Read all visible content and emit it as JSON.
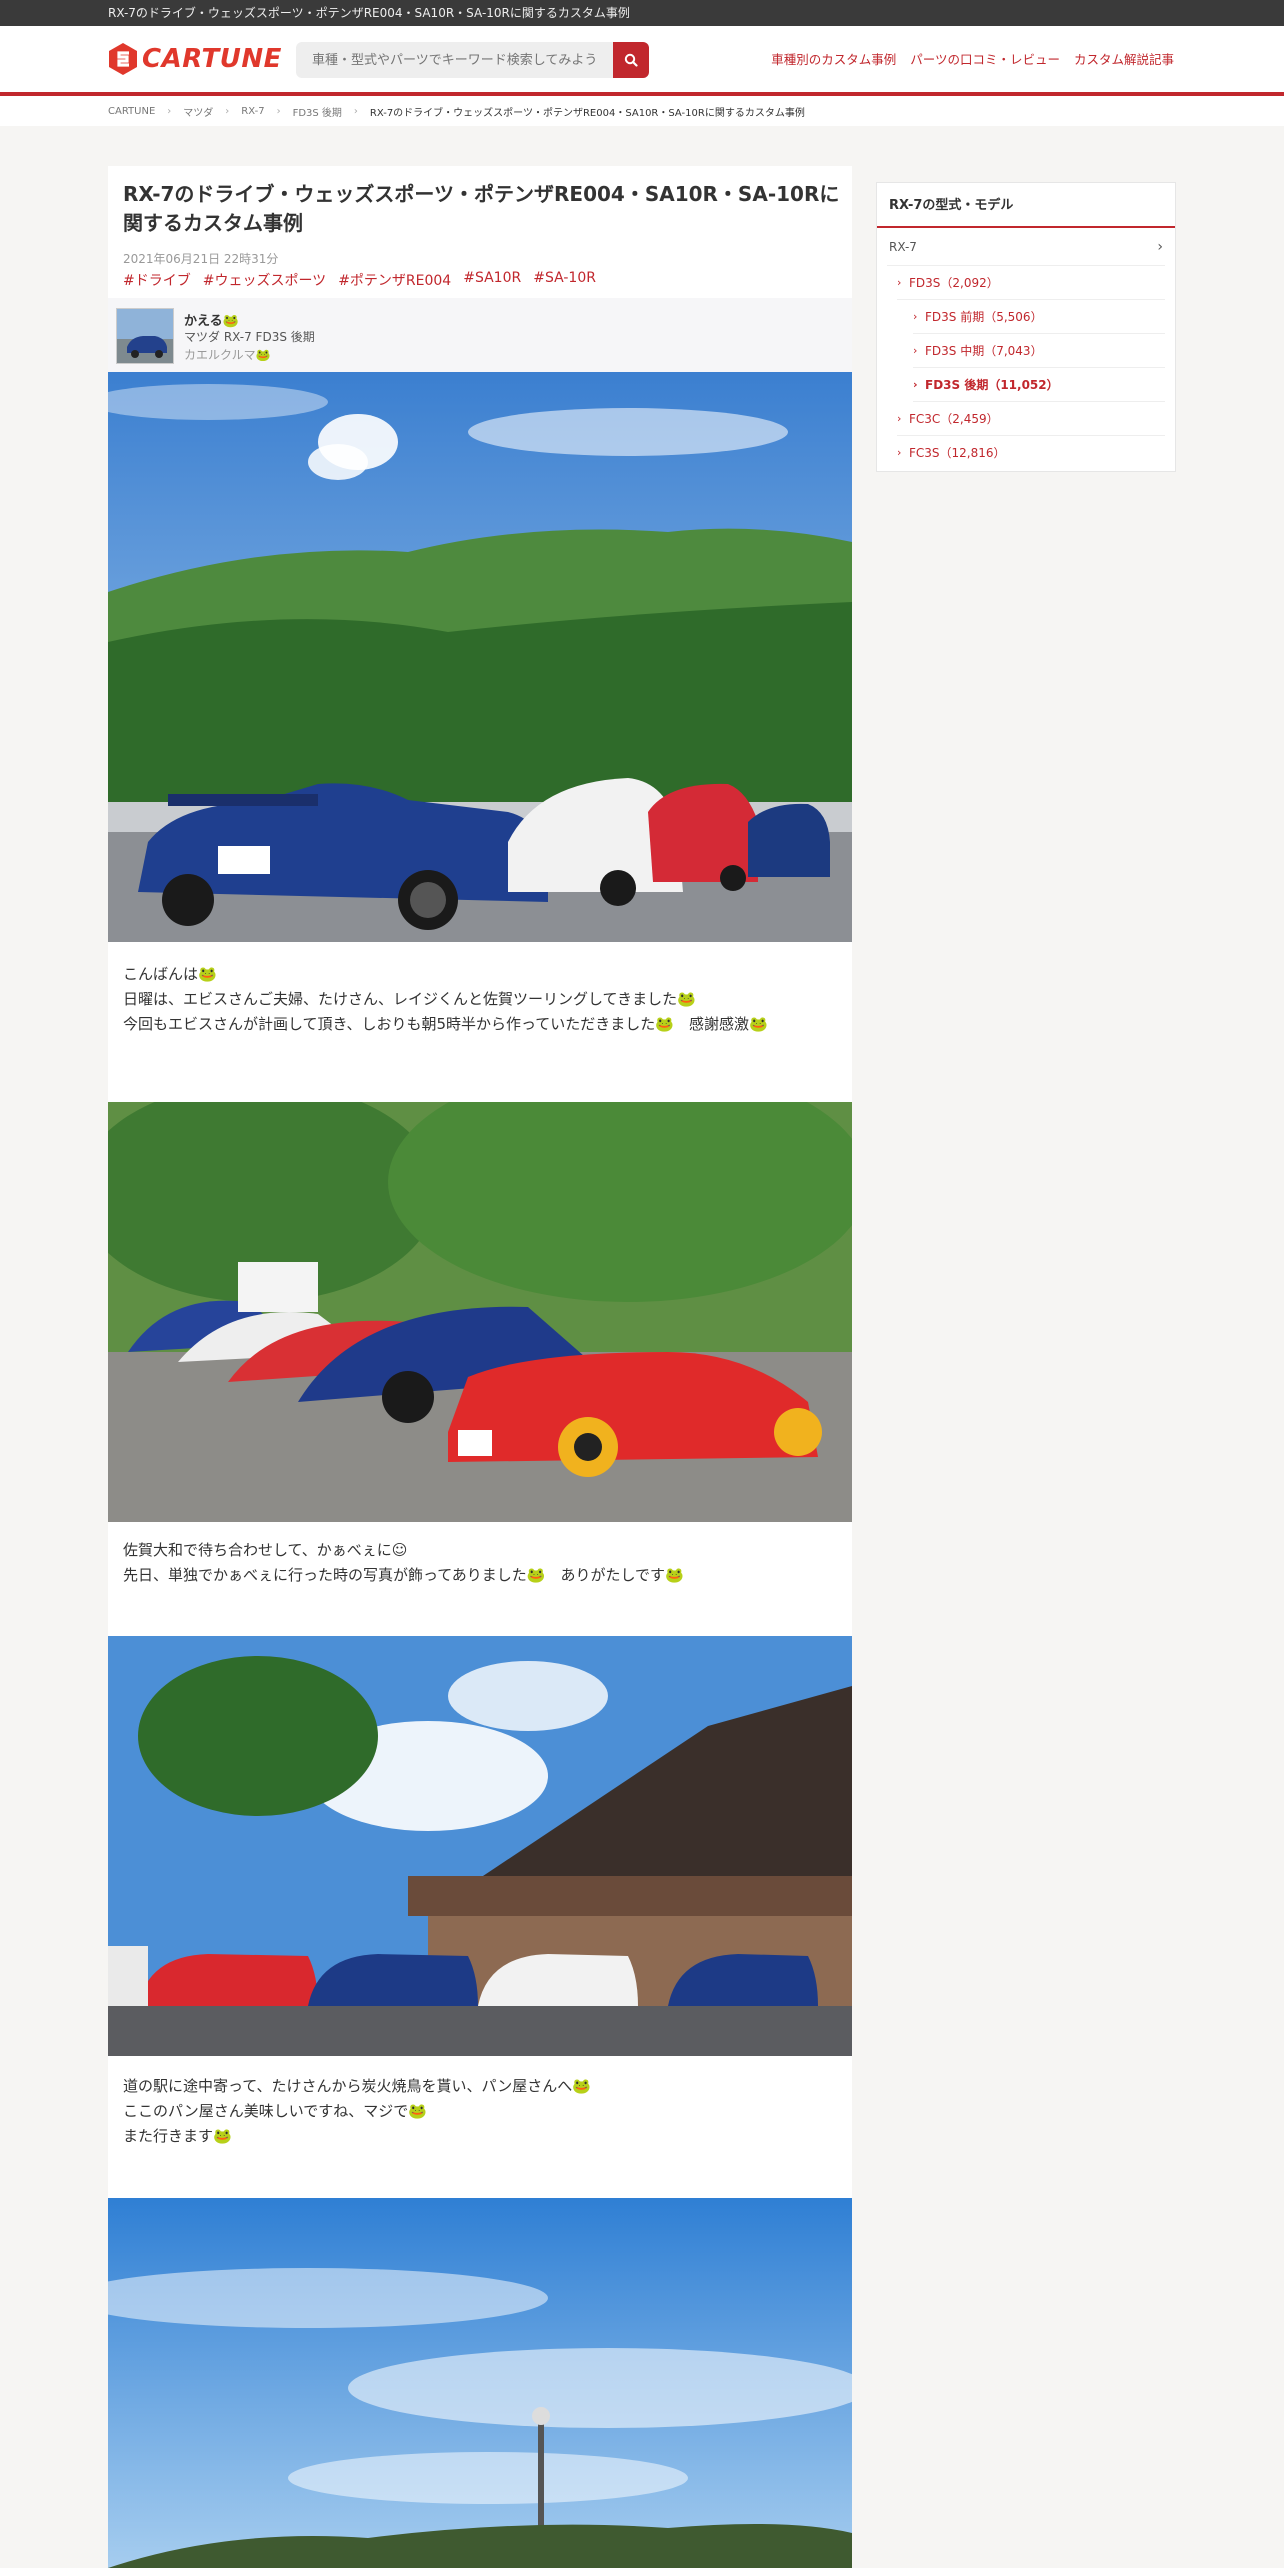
{
  "topbar": {
    "title": "RX-7のドライブ・ウェッズスポーツ・ポテンザRE004・SA10R・SA-10Rに関するカスタム事例"
  },
  "header": {
    "logo_text": "CARTUNE",
    "search_placeholder": "車種・型式やパーツでキーワード検索してみよう",
    "nav": [
      "車種別のカスタム事例",
      "パーツの口コミ・レビュー",
      "カスタム解説記事"
    ]
  },
  "breadcrumb": [
    "CARTUNE",
    "マツダ",
    "RX-7",
    "FD3S 後期",
    "RX-7のドライブ・ウェッズスポーツ・ポテンザRE004・SA10R・SA-10Rに関するカスタム事例"
  ],
  "article": {
    "title": "RX-7のドライブ・ウェッズスポーツ・ポテンザRE004・SA10R・SA-10Rに関するカスタム事例",
    "date": "2021年06月21日 22時31分",
    "tags": [
      "#ドライブ",
      "#ウェッズスポーツ",
      "#ポテンザRE004",
      "#SA10R",
      "#SA-10R"
    ],
    "author": {
      "name": "かえる🐸",
      "car": "マツダ RX-7 FD3S 後期",
      "handle": "カエルクルマ🐸"
    },
    "paragraphs": [
      [
        "こんばんは🐸",
        "日曜は、エビスさんご夫婦、たけさん、レイジくんと佐賀ツーリングしてきました🐸",
        "今回もエビスさんが計画して頂き、しおりも朝5時半から作っていただきました🐸　感謝感激🐸"
      ],
      [
        "佐賀大和で待ち合わせして、かぁべぇに☺",
        "先日、単独でかぁべぇに行った時の写真が飾ってありました🐸　ありがたしです🐸"
      ],
      [
        "道の駅に途中寄って、たけさんから炭火焼鳥を貰い、パン屋さんへ🐸",
        "ここのパン屋さん美味しいですね、マジで🐸",
        "また行きます🐸"
      ]
    ]
  },
  "sidebar": {
    "title": "RX-7の型式・モデル",
    "model": "RX-7",
    "items": [
      {
        "label": "FD3S（2,092）"
      },
      {
        "label": "FD3S 前期（5,506）"
      },
      {
        "label": "FD3S 中期（7,043）"
      },
      {
        "label": "FD3S 後期（11,052）"
      },
      {
        "label": "FC3C（2,459）"
      },
      {
        "label": "FC3S（12,816）"
      }
    ]
  },
  "colors": {
    "accent": "#c1272d",
    "topbar": "#3a3a3a",
    "background": "#f6f5f3"
  }
}
